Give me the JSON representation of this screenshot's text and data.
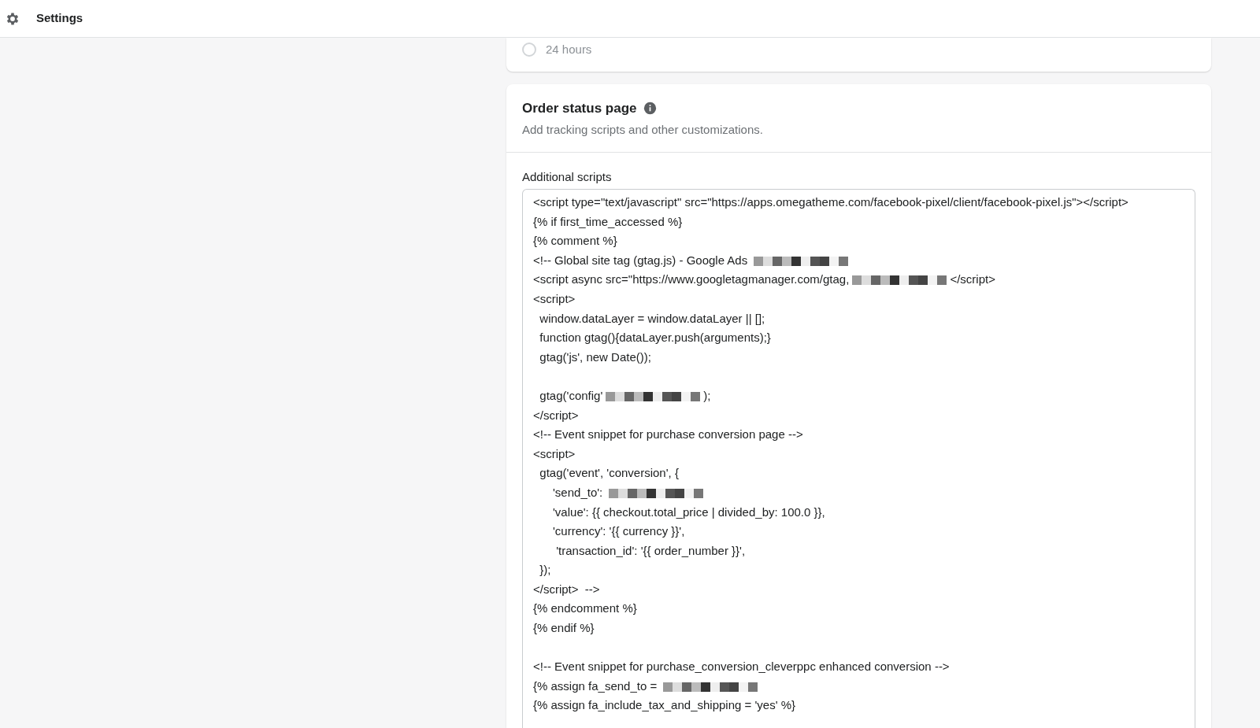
{
  "header": {
    "title": "Settings"
  },
  "previous_card": {
    "options": [
      {
        "label": "24 hours",
        "selected": false
      }
    ]
  },
  "order_status_card": {
    "title": "Order status page",
    "description": "Add tracking scripts and other customizations.",
    "field_label": "Additional scripts",
    "lines": [
      {
        "text": "<script type=\"text/javascript\" src=\"https://apps.omegatheme.com/facebook-pixel/client/facebook-pixel.js\"></script>",
        "redacted": false
      },
      {
        "text": "{% if first_time_accessed %}",
        "redacted": false
      },
      {
        "text": "{% comment %}",
        "redacted": false
      },
      {
        "text": "<!-- Global site tag (gtag.js) - Google Ads ",
        "redacted": true
      },
      {
        "text": "<script async src=\"https://www.googletagmanager.com/gtag,",
        "redacted": true,
        "suffix": "</script>"
      },
      {
        "text": "<script>",
        "redacted": false
      },
      {
        "text": "  window.dataLayer = window.dataLayer || [];",
        "redacted": false
      },
      {
        "text": "  function gtag(){dataLayer.push(arguments);}",
        "redacted": false
      },
      {
        "text": "  gtag('js', new Date());",
        "redacted": false
      },
      {
        "redacted": false
      },
      {
        "text": "  gtag('config'",
        "redacted": true,
        "suffix": ");"
      },
      {
        "text": "</script>",
        "redacted": false
      },
      {
        "text": "<!-- Event snippet for purchase conversion page -->",
        "redacted": false
      },
      {
        "text": "<script>",
        "redacted": false
      },
      {
        "text": "  gtag('event', 'conversion', {",
        "redacted": false
      },
      {
        "text": "      'send_to': ",
        "redacted": true
      },
      {
        "text": "      'value': {{ checkout.total_price | divided_by: 100.0 }},",
        "redacted": false
      },
      {
        "text": "      'currency': '{{ currency }}',",
        "redacted": false
      },
      {
        "text": "       'transaction_id': '{{ order_number }}',",
        "redacted": false
      },
      {
        "text": "  });",
        "redacted": false
      },
      {
        "text": "</script>  -->",
        "redacted": false
      },
      {
        "text": "{% endcomment %}",
        "redacted": false
      },
      {
        "text": "{% endif %}",
        "redacted": false
      },
      {
        "redacted": false
      },
      {
        "text": "<!-- Event snippet for purchase_conversion_cleverppc enhanced conversion -->",
        "redacted": false
      },
      {
        "text": "{% assign fa_send_to = ",
        "redacted": true
      },
      {
        "text": "{% assign fa_include_tax_and_shipping = 'yes' %}",
        "redacted": false
      }
    ]
  }
}
